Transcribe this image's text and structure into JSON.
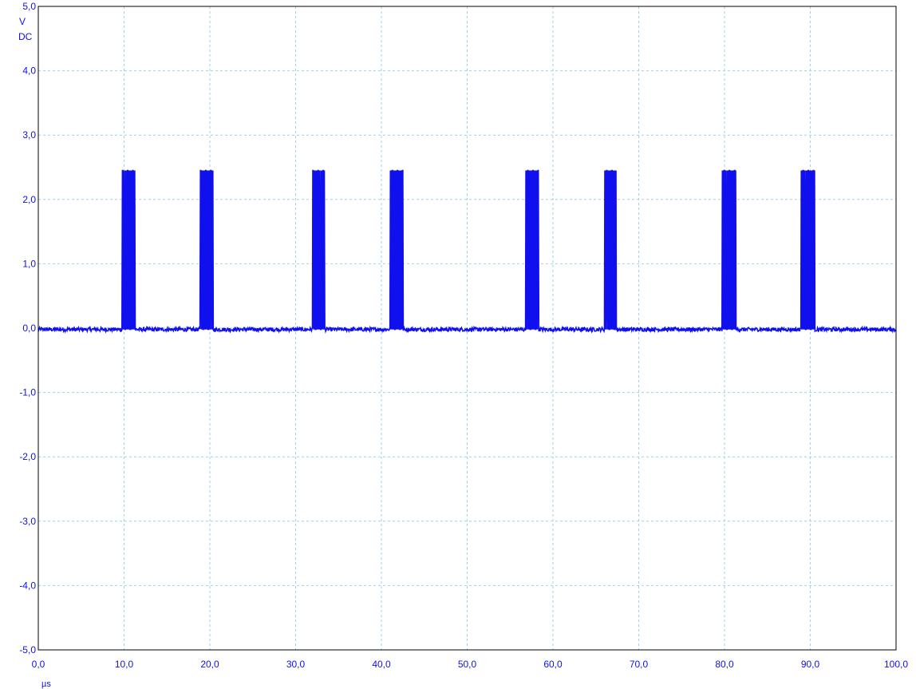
{
  "colors": {
    "trace": "#1010ee",
    "axis_text": "#1010ee",
    "grid": "#9ed2ea",
    "frame": "#000000",
    "background": "#ffffff"
  },
  "chart_data": {
    "type": "line",
    "xlabel": "µs",
    "ylabel_unit": "V",
    "ylabel_coupling": "DC",
    "xlim": [
      0,
      100
    ],
    "ylim": [
      -5,
      5
    ],
    "x_ticks": [
      "0,0",
      "10,0",
      "20,0",
      "30,0",
      "40,0",
      "50,0",
      "60,0",
      "70,0",
      "80,0",
      "90,0",
      "100,0"
    ],
    "y_ticks": [
      "5,0",
      "4,0",
      "3,0",
      "2,0",
      "1,0",
      "0,0",
      "-1,0",
      "-2,0",
      "-3,0",
      "-4,0",
      "-5,0"
    ],
    "grid": true,
    "baseline": -0.02,
    "high_level": 2.45,
    "bursts": [
      {
        "start": 9.8,
        "end": 11.3,
        "mid": 2.2
      },
      {
        "start": 18.9,
        "end": 20.4,
        "mid": 2.1
      },
      {
        "start": 32.0,
        "end": 33.4,
        "mid": 1.35
      },
      {
        "start": 41.0,
        "end": 42.5,
        "mid": 2.4
      },
      {
        "start": 56.8,
        "end": 58.3,
        "mid": 2.45
      },
      {
        "start": 66.0,
        "end": 67.4,
        "mid": 2.1
      },
      {
        "start": 79.7,
        "end": 81.3,
        "mid": 1.3
      },
      {
        "start": 88.9,
        "end": 90.5,
        "mid": 1.6
      }
    ]
  }
}
